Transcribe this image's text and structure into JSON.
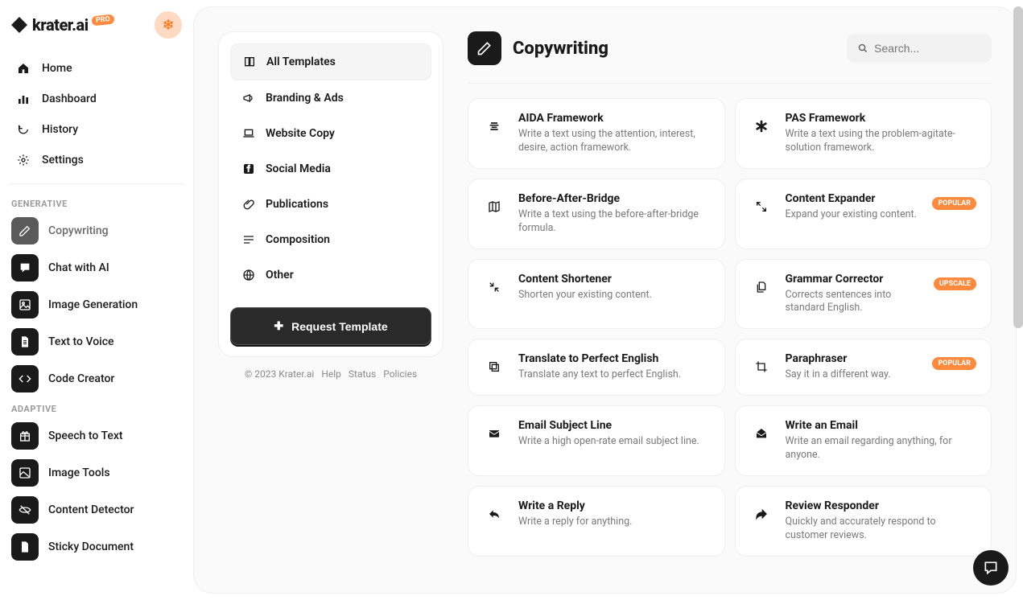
{
  "brand": {
    "name": "krater.ai",
    "badge": "PRO"
  },
  "sidebar": {
    "main": [
      {
        "label": "Home",
        "icon": "home"
      },
      {
        "label": "Dashboard",
        "icon": "chart"
      },
      {
        "label": "History",
        "icon": "refresh"
      },
      {
        "label": "Settings",
        "icon": "gear"
      }
    ],
    "sections": [
      {
        "label": "GENERATIVE",
        "items": [
          {
            "label": "Copywriting",
            "icon": "pencil",
            "active": true
          },
          {
            "label": "Chat with AI",
            "icon": "chat"
          },
          {
            "label": "Image Generation",
            "icon": "image"
          },
          {
            "label": "Text to Voice",
            "icon": "doc"
          },
          {
            "label": "Code Creator",
            "icon": "code"
          }
        ]
      },
      {
        "label": "ADAPTIVE",
        "items": [
          {
            "label": "Speech to Text",
            "icon": "gift"
          },
          {
            "label": "Image Tools",
            "icon": "img2"
          },
          {
            "label": "Content Detector",
            "icon": "eye"
          },
          {
            "label": "Sticky Document",
            "icon": "file"
          }
        ]
      }
    ]
  },
  "categories": [
    {
      "label": "All Templates",
      "icon": "book",
      "active": true
    },
    {
      "label": "Branding & Ads",
      "icon": "megaphone"
    },
    {
      "label": "Website Copy",
      "icon": "laptop"
    },
    {
      "label": "Social Media",
      "icon": "facebook"
    },
    {
      "label": "Publications",
      "icon": "clip"
    },
    {
      "label": "Composition",
      "icon": "lines"
    },
    {
      "label": "Other",
      "icon": "globe"
    }
  ],
  "request_button": "Request Template",
  "footer": {
    "copyright": "© 2023 Krater.ai",
    "links": [
      "Help",
      "Status",
      "Policies"
    ]
  },
  "header": {
    "title": "Copywriting",
    "search_placeholder": "Search..."
  },
  "cards": [
    {
      "title": "AIDA Framework",
      "desc": "Write a text using the attention, interest, desire, action framework.",
      "icon": "align"
    },
    {
      "title": "PAS Framework",
      "desc": "Write a text using the problem-agitate-solution framework.",
      "icon": "asterisk"
    },
    {
      "title": "Before-After-Bridge",
      "desc": "Write a text using the before-after-bridge formula.",
      "icon": "map"
    },
    {
      "title": "Content Expander",
      "desc": "Expand your existing content.",
      "icon": "expand",
      "badge": "POPULAR"
    },
    {
      "title": "Content Shortener",
      "desc": "Shorten your existing content.",
      "icon": "compress"
    },
    {
      "title": "Grammar Corrector",
      "desc": "Corrects sentences into standard English.",
      "icon": "files",
      "badge": "UPSCALE"
    },
    {
      "title": "Translate to Perfect English",
      "desc": "Translate any text to perfect English.",
      "icon": "copy"
    },
    {
      "title": "Paraphraser",
      "desc": "Say it in a different way.",
      "icon": "crop",
      "badge": "POPULAR"
    },
    {
      "title": "Email Subject Line",
      "desc": "Write a high open-rate email subject line.",
      "icon": "mail"
    },
    {
      "title": "Write an Email",
      "desc": "Write an email regarding anything, for anyone.",
      "icon": "mailopen"
    },
    {
      "title": "Write a Reply",
      "desc": "Write a reply for anything.",
      "icon": "reply"
    },
    {
      "title": "Review Responder",
      "desc": "Quickly and accurately respond to customer reviews.",
      "icon": "share"
    }
  ]
}
